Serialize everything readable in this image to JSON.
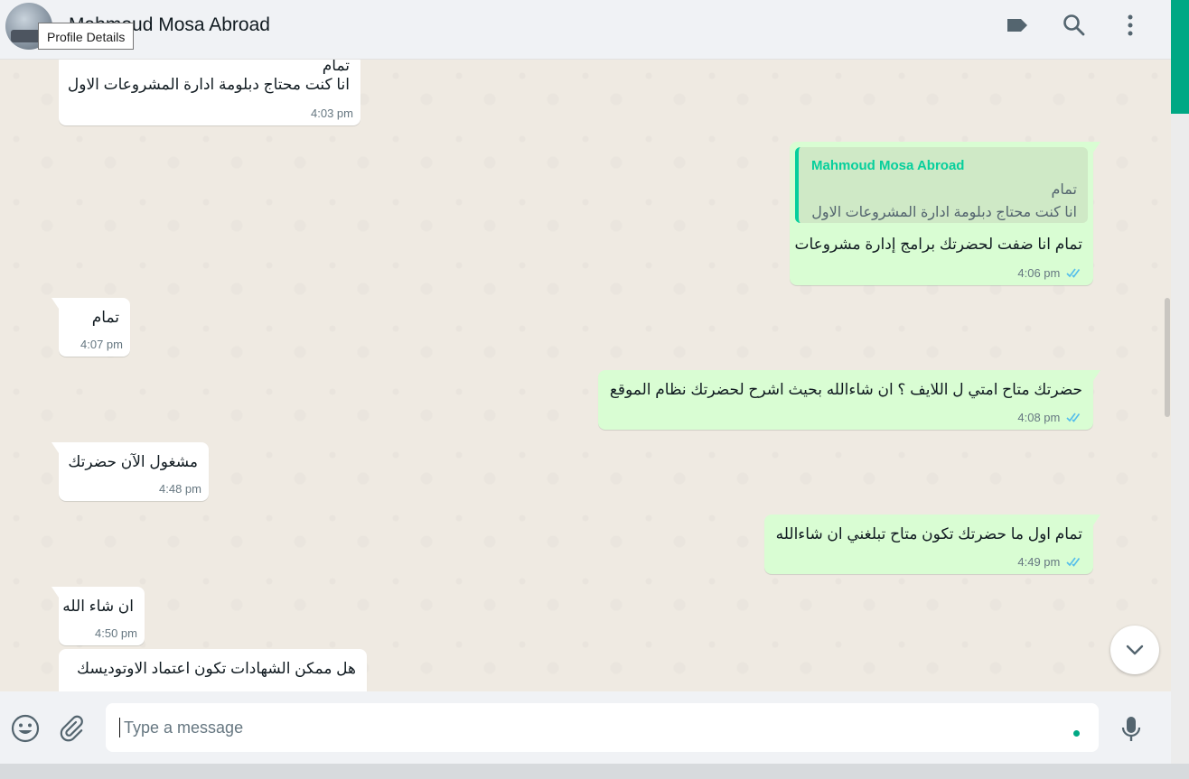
{
  "header": {
    "contact_name": "Mahmoud Mosa Abroad",
    "tooltip": "Profile Details",
    "icons": [
      "label-icon",
      "search-icon",
      "menu-icon"
    ]
  },
  "messages": [
    {
      "dir": "in",
      "lines": [
        "تمام",
        "انا كنت محتاج دبلومة ادارة المشروعات الاول"
      ],
      "time": "4:03 pm"
    },
    {
      "dir": "out",
      "quote": {
        "name": "Mahmoud Mosa Abroad",
        "lines": [
          "تمام",
          "انا كنت محتاج دبلومة ادارة المشروعات الاول"
        ]
      },
      "lines": [
        "تمام انا ضفت لحضرتك برامج إدارة مشروعات"
      ],
      "time": "4:06 pm",
      "status": "read"
    },
    {
      "dir": "in",
      "lines": [
        "تمام"
      ],
      "time": "4:07 pm"
    },
    {
      "dir": "out",
      "lines": [
        "حضرتك متاح امتي ل اللايف ؟ ان شاءالله بحيث اشرح لحضرتك نظام الموقع"
      ],
      "time": "4:08 pm",
      "status": "read"
    },
    {
      "dir": "in",
      "lines": [
        "مشغول الآن حضرتك"
      ],
      "time": "4:48 pm"
    },
    {
      "dir": "out",
      "lines": [
        "تمام اول ما حضرتك تكون متاح تبلغني ان شاءالله"
      ],
      "time": "4:49 pm",
      "status": "read"
    },
    {
      "dir": "in",
      "lines": [
        "ان شاء الله"
      ],
      "time": "4:50 pm"
    },
    {
      "dir": "in",
      "lines": [
        "هل ممكن الشهادات تكون اعتماد الاوتوديسك"
      ],
      "time": ""
    }
  ],
  "composer": {
    "placeholder": "Type a message",
    "icons": [
      "emoji-icon",
      "attach-icon",
      "microphone-icon"
    ]
  },
  "colors": {
    "accent": "#00a884",
    "outgoing_bubble": "#d9fdd3",
    "incoming_bubble": "#ffffff",
    "read_tick": "#53bdeb",
    "chat_background": "#efeae2"
  }
}
